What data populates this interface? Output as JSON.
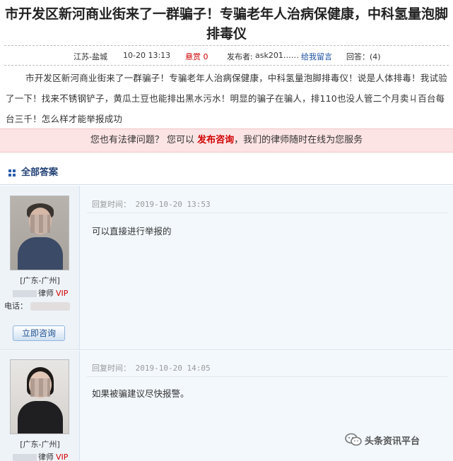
{
  "question": {
    "title": "市开发区新河商业街来了一群骗子！专骗老年人治病保健康，中科氢量泡脚排毒仪",
    "meta": {
      "location": "江苏-盐城",
      "time": "10-20 13:13",
      "reward": "悬赏 0",
      "poster_label": "发布者:",
      "poster": "ask201……",
      "message_link": "给我留言",
      "answers_count": "回答：(4)"
    },
    "body": "市开发区新河商业街来了一群骗子！专骗老年人治病保健康，中科氢量泡脚排毒仪！说是人体排毒！我试验了一下！找来不锈钢铲子，黄瓜土豆也能排出黑水污水！明显的骗子在骗人，排110也没人管二个月卖ㄐ百台每台三千！怎么样才能举报成功"
  },
  "promo": {
    "before": "您也有法律问题？ 您可以",
    "link": "发布咨询",
    "after": "，我们的律师随时在线为您服务"
  },
  "answers_header": {
    "label": "全部答案"
  },
  "answers": [
    {
      "region": "[广东-广州]",
      "lawyer_suffix": "律师",
      "vip": "VIP",
      "phone_label": "电话：",
      "consult_label": "立即咨询",
      "reply_time": "回复时间： 2019-10-20 13:53",
      "reply_text": "可以直接进行举报的"
    },
    {
      "region": "[广东-广州]",
      "lawyer_suffix": "律师",
      "vip": "VIP",
      "reply_time": "回复时间： 2019-10-20 14:05",
      "reply_text": "如果被骗建议尽快报警。"
    }
  ],
  "watermark": {
    "text": "头条资讯平台"
  },
  "colors": {
    "accent_red": "#d00000",
    "link_blue": "#1a4fa0",
    "promo_bg": "#fde4e4",
    "panel_bg": "#f3f8fc"
  }
}
